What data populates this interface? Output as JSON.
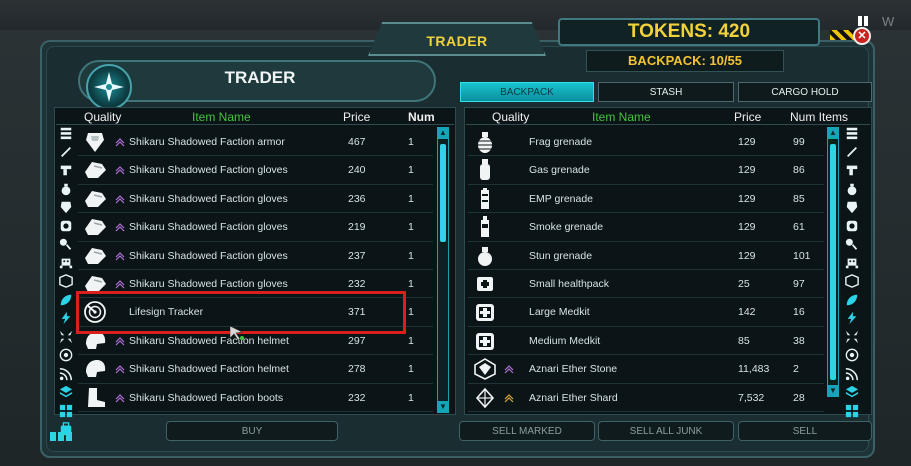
{
  "top": {
    "trader_tab": "TRADER",
    "tokens": "TOKENS: 420",
    "backpack": "BACKPACK: 10/55",
    "corner_letter": "W",
    "close_icon": "close-icon"
  },
  "trader": {
    "title": "TRADER",
    "columns": {
      "quality": "Quality",
      "item_name": "Item Name",
      "price": "Price",
      "num": "Num"
    },
    "items": [
      {
        "name": "Shikaru Shadowed Faction armor",
        "price": "467",
        "num": "1",
        "icon": "armor-icon"
      },
      {
        "name": "Shikaru Shadowed Faction gloves",
        "price": "240",
        "num": "1",
        "icon": "gloves-icon"
      },
      {
        "name": "Shikaru Shadowed Faction gloves",
        "price": "236",
        "num": "1",
        "icon": "gloves-icon"
      },
      {
        "name": "Shikaru Shadowed Faction gloves",
        "price": "219",
        "num": "1",
        "icon": "gloves-icon"
      },
      {
        "name": "Shikaru Shadowed Faction gloves",
        "price": "237",
        "num": "1",
        "icon": "gloves-icon"
      },
      {
        "name": "Shikaru Shadowed Faction gloves",
        "price": "232",
        "num": "1",
        "icon": "gloves-icon"
      },
      {
        "name": "Lifesign Tracker",
        "price": "371",
        "num": "1",
        "icon": "tracker-icon"
      },
      {
        "name": "Shikaru Shadowed Faction helmet",
        "price": "297",
        "num": "1",
        "icon": "helmet-icon"
      },
      {
        "name": "Shikaru Shadowed Faction helmet",
        "price": "278",
        "num": "1",
        "icon": "helmet-icon"
      },
      {
        "name": "Shikaru Shadowed Faction boots",
        "price": "232",
        "num": "1",
        "icon": "boots-icon"
      }
    ],
    "buy_label": "BUY"
  },
  "inventory": {
    "tabs": [
      {
        "label": "BACKPACK",
        "active": true
      },
      {
        "label": "STASH",
        "active": false
      },
      {
        "label": "CARGO HOLD",
        "active": false
      }
    ],
    "columns": {
      "quality": "Quality",
      "item_name": "Item Name",
      "price": "Price",
      "num_items": "Num Items"
    },
    "items": [
      {
        "name": "Frag grenade",
        "price": "129",
        "num": "99",
        "icon": "frag-grenade-icon"
      },
      {
        "name": "Gas grenade",
        "price": "129",
        "num": "86",
        "icon": "gas-grenade-icon"
      },
      {
        "name": "EMP grenade",
        "price": "129",
        "num": "85",
        "icon": "emp-grenade-icon"
      },
      {
        "name": "Smoke grenade",
        "price": "129",
        "num": "61",
        "icon": "smoke-grenade-icon"
      },
      {
        "name": "Stun grenade",
        "price": "129",
        "num": "101",
        "icon": "stun-grenade-icon"
      },
      {
        "name": "Small healthpack",
        "price": "25",
        "num": "97",
        "icon": "healthpack-icon"
      },
      {
        "name": "Large Medkit",
        "price": "142",
        "num": "16",
        "icon": "medkit-icon"
      },
      {
        "name": "Medium Medkit",
        "price": "85",
        "num": "38",
        "icon": "medkit-icon"
      },
      {
        "name": "Aznari Ether Stone",
        "price": "11,483",
        "num": "2",
        "icon": "ether-stone-icon"
      },
      {
        "name": "Aznari Ether Shard",
        "price": "7,532",
        "num": "28",
        "icon": "ether-shard-icon"
      }
    ],
    "sell_marked_label": "SELL MARKED",
    "sell_all_junk_label": "SELL ALL JUNK",
    "sell_label": "SELL"
  },
  "category_icons": [
    "all-icon",
    "weapon-icon",
    "pistol-icon",
    "grenade-icon",
    "armor-icon",
    "shield-icon",
    "key-icon",
    "alien-icon",
    "box-icon",
    "leaf-icon",
    "lightning-icon",
    "compress-icon",
    "target-icon",
    "signal-icon",
    "layers-icon",
    "grid-icon",
    "backpack-icon"
  ],
  "colors": {
    "accent": "#18c3cf",
    "gold": "#f2d23a",
    "green_header": "#46c43c",
    "highlight": "#d9201c",
    "rarity_purple": "#b070d8",
    "rarity_gold": "#d9a53a"
  }
}
